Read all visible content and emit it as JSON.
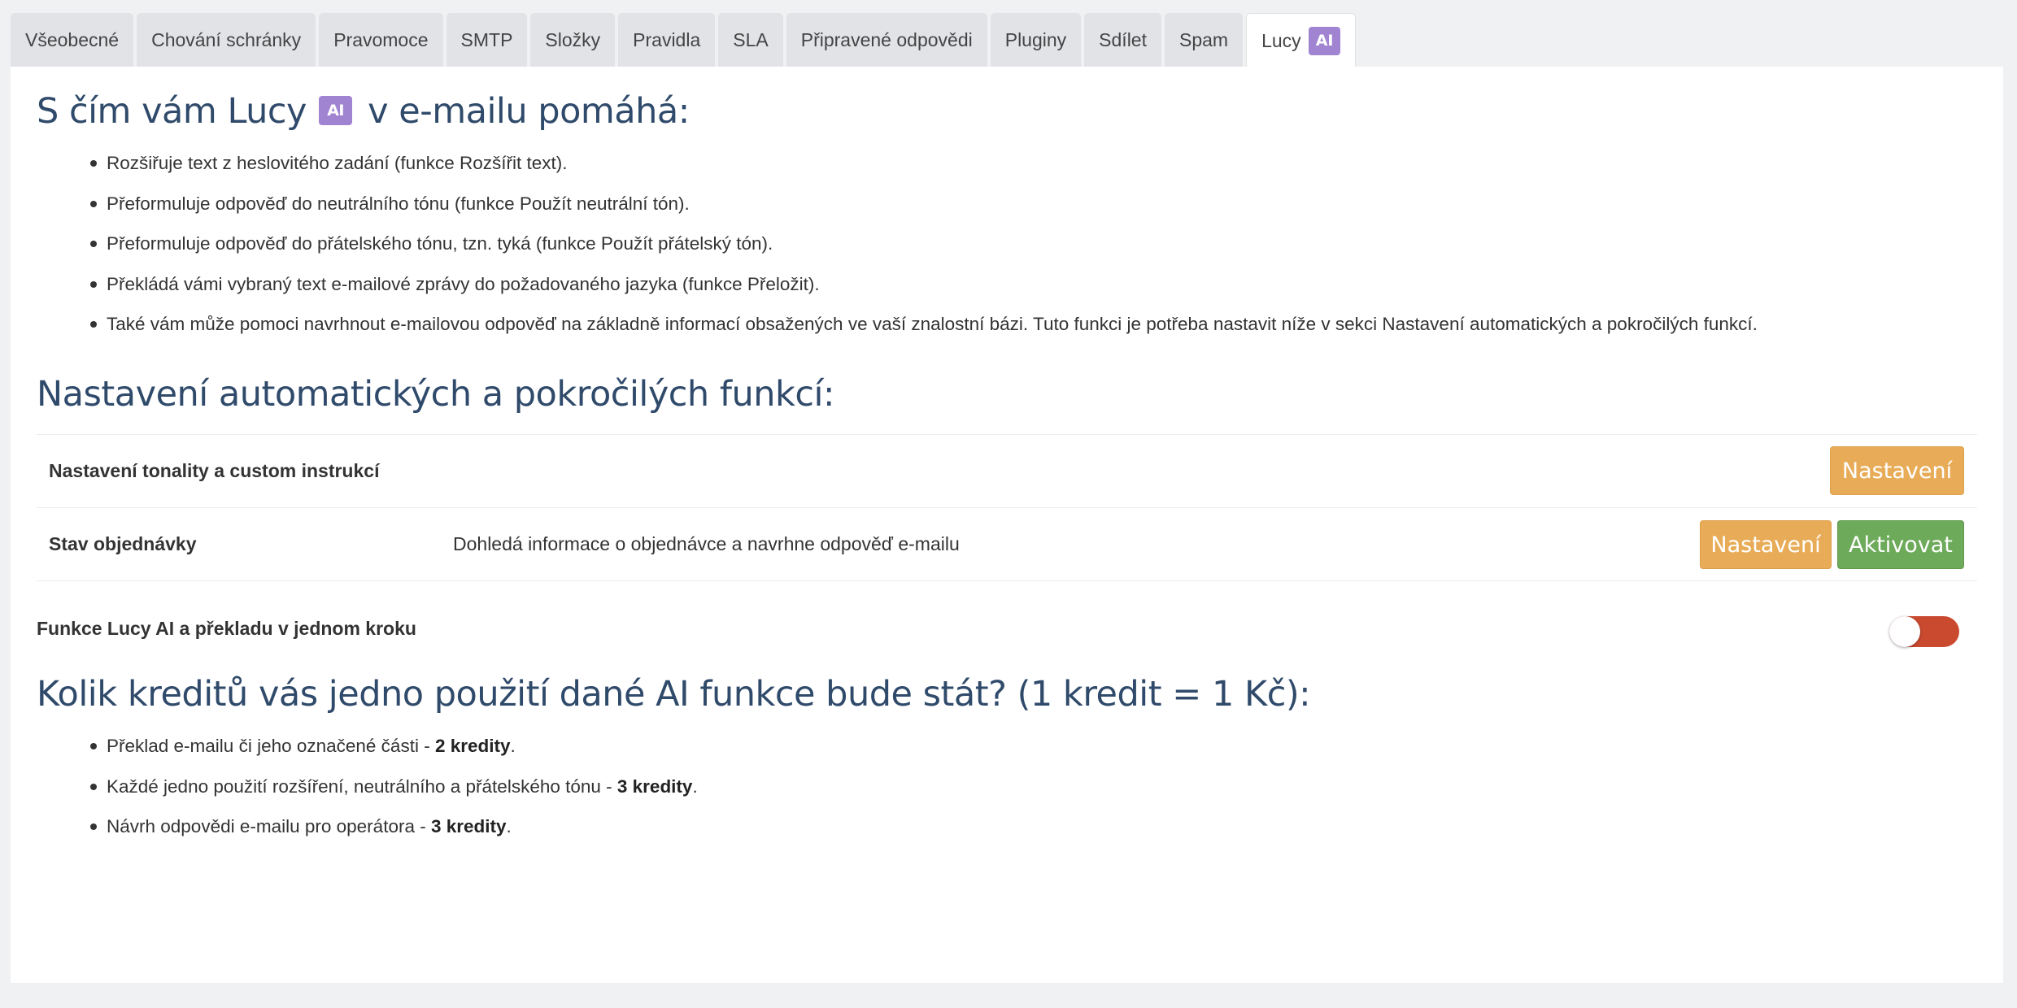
{
  "tabs": [
    {
      "label": "Všeobecné"
    },
    {
      "label": "Chování schránky"
    },
    {
      "label": "Pravomoce"
    },
    {
      "label": "SMTP"
    },
    {
      "label": "Složky"
    },
    {
      "label": "Pravidla"
    },
    {
      "label": "SLA"
    },
    {
      "label": "Připravené odpovědi"
    },
    {
      "label": "Pluginy"
    },
    {
      "label": "Sdílet"
    },
    {
      "label": "Spam"
    },
    {
      "label": "Lucy",
      "badge": "AI",
      "active": true
    }
  ],
  "intro": {
    "heading_before": "S čím vám Lucy",
    "heading_badge": "AI",
    "heading_after": "v e-mailu pomáhá:",
    "items": [
      "Rozšiřuje text z heslovitého zadání (funkce Rozšířit text).",
      "Přeformuluje odpověď do neutrálního tónu (funkce Použít neutrální tón).",
      "Přeformuluje odpověď do přátelského tónu, tzn. tyká (funkce Použít přátelský tón).",
      "Překládá vámi vybraný text e-mailové zprávy do požadovaného jazyka (funkce Přeložit).",
      "Také vám může pomoci navrhnout e-mailovou odpověď na základně informací obsažených ve vaší znalostní bázi. Tuto funkci je potřeba nastavit níže v sekci Nastavení automatických a pokročilých funkcí."
    ]
  },
  "advanced": {
    "heading": "Nastavení automatických a pokročilých funkcí:",
    "rows": [
      {
        "label": "Nastavení tonality a custom instrukcí",
        "description": "",
        "settings_label": "Nastavení"
      },
      {
        "label": "Stav objednávky",
        "description": "Dohledá informace o objednávce a navrhne odpověď e-mailu",
        "settings_label": "Nastavení",
        "activate_label": "Aktivovat"
      }
    ]
  },
  "toggle_row": {
    "label": "Funkce Lucy AI a překladu v jednom kroku",
    "enabled": false
  },
  "credits": {
    "heading": "Kolik kreditů vás jedno použití dané AI funkce bude stát? (1 kredit = 1 Kč):",
    "items": [
      {
        "text": "Překlad e-mailu či jeho označené části - ",
        "bold": "2 kredity",
        "end": "."
      },
      {
        "text": "Každé jedno použití rozšíření, neutrálního a přátelského tónu - ",
        "bold": "3 kredity",
        "end": "."
      },
      {
        "text": "Návrh odpovědi e-mailu pro operátora - ",
        "bold": "3 kredity",
        "end": "."
      }
    ]
  },
  "colors": {
    "ai_badge": "#a084d2",
    "heading": "#2f4a6a",
    "settings_button": "#e8ac58",
    "activate_button": "#6daa5a",
    "toggle_off": "#c94a2f"
  }
}
